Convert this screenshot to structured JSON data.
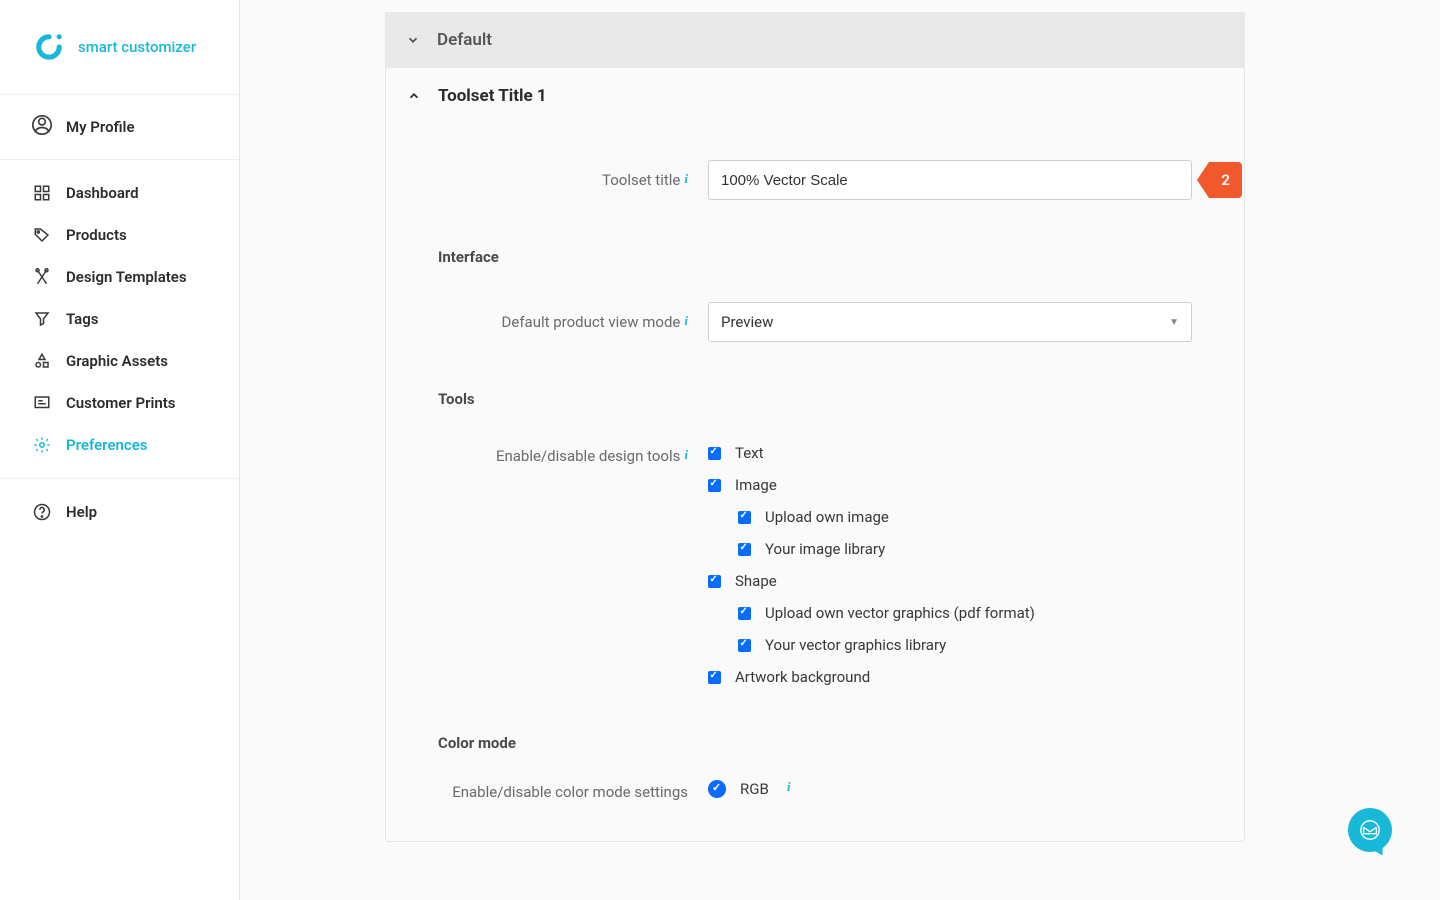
{
  "brand": {
    "name": "smart customizer"
  },
  "profile": {
    "label": "My Profile"
  },
  "nav": {
    "items": [
      {
        "label": "Dashboard",
        "name": "sidebar-item-dashboard",
        "active": false
      },
      {
        "label": "Products",
        "name": "sidebar-item-products",
        "active": false
      },
      {
        "label": "Design Templates",
        "name": "sidebar-item-design-templates",
        "active": false
      },
      {
        "label": "Tags",
        "name": "sidebar-item-tags",
        "active": false
      },
      {
        "label": "Graphic Assets",
        "name": "sidebar-item-graphic-assets",
        "active": false
      },
      {
        "label": "Customer Prints",
        "name": "sidebar-item-customer-prints",
        "active": false
      },
      {
        "label": "Preferences",
        "name": "sidebar-item-preferences",
        "active": true
      }
    ],
    "help": "Help"
  },
  "panels": {
    "collapsed": {
      "title": "Default"
    },
    "open": {
      "title": "Toolset Title 1"
    }
  },
  "form": {
    "toolset_title": {
      "label": "Toolset title",
      "value": "100% Vector Scale",
      "badge": "2"
    },
    "interface": {
      "heading": "Interface",
      "view_mode": {
        "label": "Default product view mode",
        "value": "Preview"
      }
    },
    "tools": {
      "heading": "Tools",
      "label": "Enable/disable design tools",
      "items": [
        {
          "label": "Text",
          "checked": true,
          "nested": false
        },
        {
          "label": "Image",
          "checked": true,
          "nested": false
        },
        {
          "label": "Upload own image",
          "checked": true,
          "nested": true
        },
        {
          "label": "Your image library",
          "checked": true,
          "nested": true
        },
        {
          "label": "Shape",
          "checked": true,
          "nested": false
        },
        {
          "label": "Upload own vector graphics (pdf format)",
          "checked": true,
          "nested": true
        },
        {
          "label": "Your vector graphics library",
          "checked": true,
          "nested": true
        },
        {
          "label": "Artwork background",
          "checked": true,
          "nested": false
        }
      ]
    },
    "color_mode": {
      "heading": "Color mode",
      "label": "Enable/disable color mode settings",
      "option": "RGB"
    }
  }
}
